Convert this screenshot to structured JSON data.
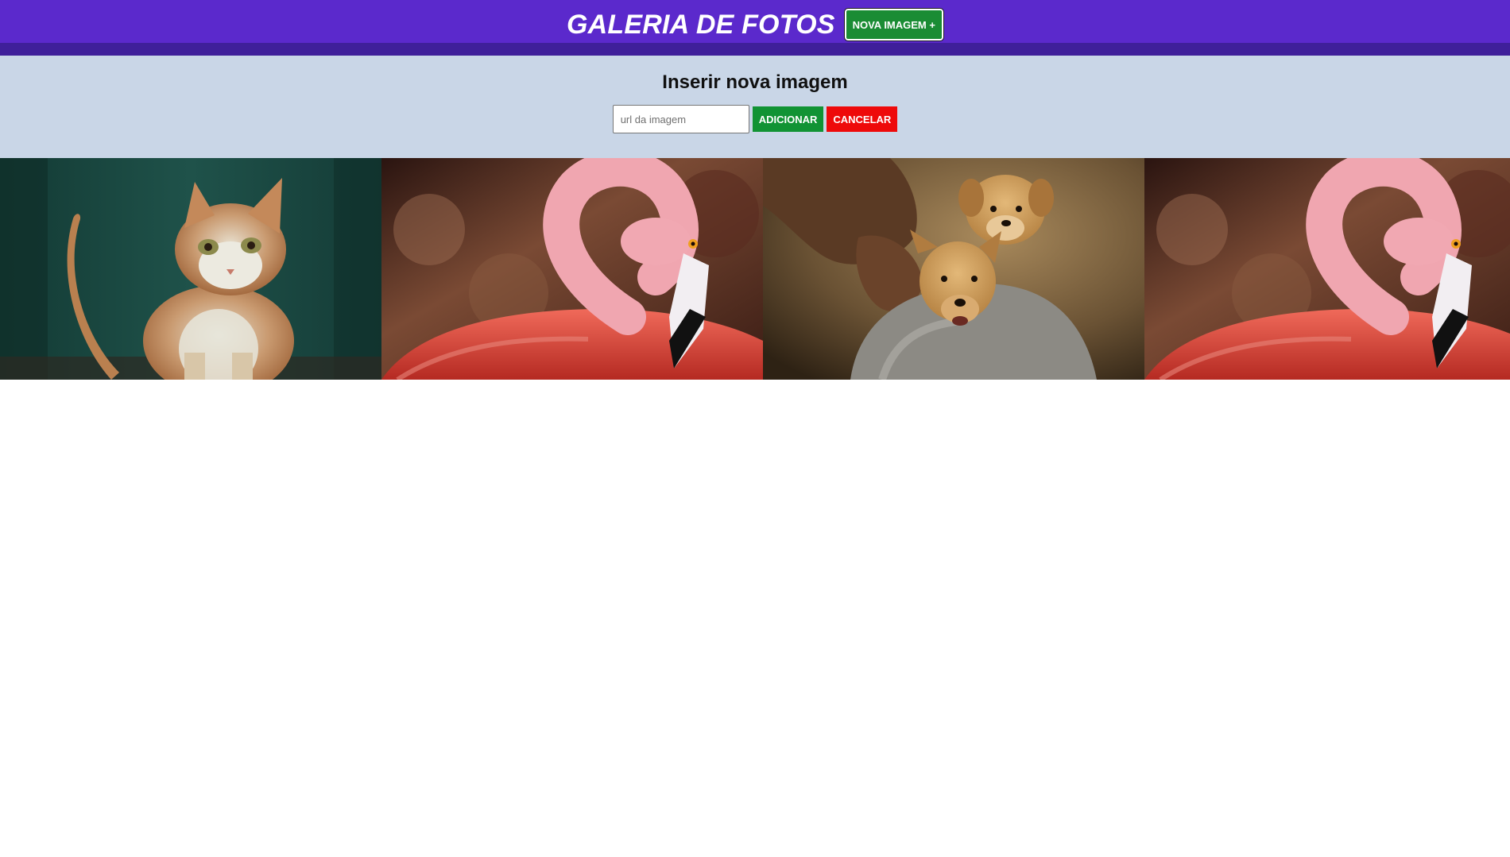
{
  "header": {
    "title": "GALERIA DE FOTOS",
    "new_image_button": "NOVA IMAGEM +"
  },
  "insert_panel": {
    "title": "Inserir nova imagem",
    "url_placeholder": "url da imagem",
    "add_button": "ADICIONAR",
    "cancel_button": "CANCELAR"
  },
  "gallery": {
    "photos": [
      {
        "subject": "cat"
      },
      {
        "subject": "flamingo"
      },
      {
        "subject": "puppies"
      },
      {
        "subject": "flamingo"
      }
    ]
  },
  "colors": {
    "header_bg": "#5b29cc",
    "header_border": "#3f1f9a",
    "panel_bg": "#c9d6e7",
    "add_green": "#119334",
    "cancel_red": "#ee0a0a"
  }
}
